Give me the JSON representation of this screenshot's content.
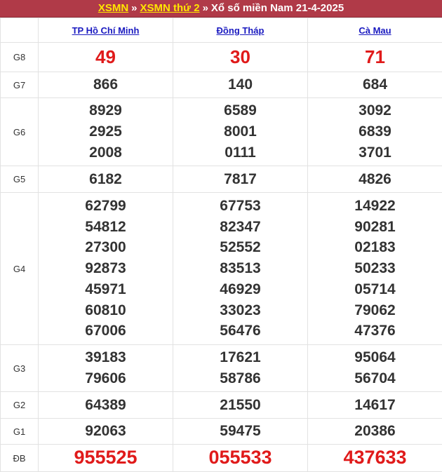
{
  "header": {
    "link1": "XSMN",
    "sep1": "»",
    "link2": "XSMN thứ 2",
    "sep2": "»",
    "title": "Xổ số miền Nam 21-4-2025"
  },
  "provinces": [
    "TP Hồ Chí Minh",
    "Đồng Tháp",
    "Cà Mau"
  ],
  "prizes": [
    {
      "label": "G8",
      "style": "red",
      "values": [
        [
          "49"
        ],
        [
          "30"
        ],
        [
          "71"
        ]
      ]
    },
    {
      "label": "G7",
      "style": "normal",
      "values": [
        [
          "866"
        ],
        [
          "140"
        ],
        [
          "684"
        ]
      ]
    },
    {
      "label": "G6",
      "style": "normal",
      "values": [
        [
          "8929",
          "2925",
          "2008"
        ],
        [
          "6589",
          "8001",
          "0111"
        ],
        [
          "3092",
          "6839",
          "3701"
        ]
      ]
    },
    {
      "label": "G5",
      "style": "normal",
      "values": [
        [
          "6182"
        ],
        [
          "7817"
        ],
        [
          "4826"
        ]
      ]
    },
    {
      "label": "G4",
      "style": "normal",
      "values": [
        [
          "62799",
          "54812",
          "27300",
          "92873",
          "45971",
          "60810",
          "67006"
        ],
        [
          "67753",
          "82347",
          "52552",
          "83513",
          "46929",
          "33023",
          "56476"
        ],
        [
          "14922",
          "90281",
          "02183",
          "50233",
          "05714",
          "79062",
          "47376"
        ]
      ]
    },
    {
      "label": "G3",
      "style": "normal",
      "values": [
        [
          "39183",
          "79606"
        ],
        [
          "17621",
          "58786"
        ],
        [
          "95064",
          "56704"
        ]
      ]
    },
    {
      "label": "G2",
      "style": "normal",
      "values": [
        [
          "64389"
        ],
        [
          "21550"
        ],
        [
          "14617"
        ]
      ]
    },
    {
      "label": "G1",
      "style": "normal",
      "values": [
        [
          "92063"
        ],
        [
          "59475"
        ],
        [
          "20386"
        ]
      ]
    },
    {
      "label": "ĐB",
      "style": "special",
      "values": [
        [
          "955525"
        ],
        [
          "055533"
        ],
        [
          "437633"
        ]
      ]
    }
  ],
  "colors": {
    "title_bar": "#b03a48",
    "title_link": "#ffe600",
    "province_link": "#1a1ac0",
    "highlight_number": "#e01a1a",
    "number": "#333333"
  }
}
